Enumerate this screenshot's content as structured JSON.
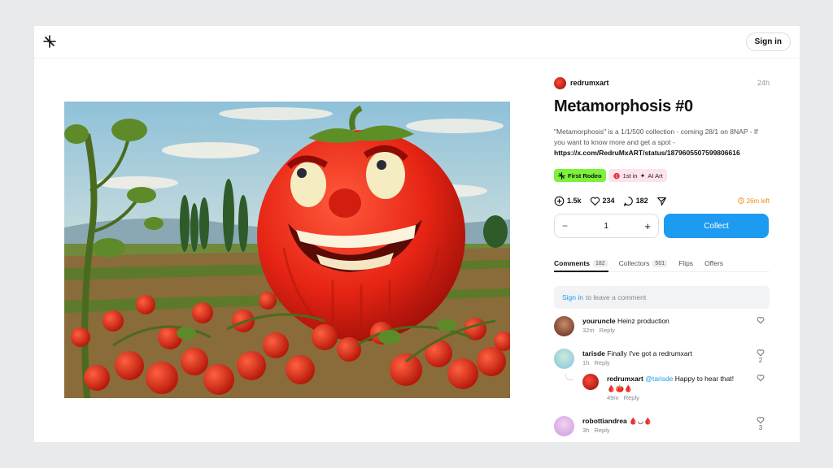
{
  "header": {
    "signin_label": "Sign in"
  },
  "post": {
    "author": "redrumxart",
    "time": "24h",
    "title": "Metamorphosis #0",
    "description": "\"Metamorphosis\" is a 1/1/500 collection - coming 28/1 on 8NAP - If you want to know more and get a spot -",
    "link": "https://x.com/RedruMxART/status/1879605507599806616",
    "tags": {
      "first_rodeo": "First Rodeo",
      "first_in": "1st in",
      "ai_art": "AI Art"
    },
    "stats": {
      "collects": "1.5k",
      "likes": "234",
      "comments": "182"
    },
    "time_left": "26m left",
    "quantity": "1",
    "minus": "−",
    "plus": "+",
    "collect_label": "Collect"
  },
  "tabs": [
    {
      "label": "Comments",
      "count": "182"
    },
    {
      "label": "Collectors",
      "count": "501"
    },
    {
      "label": "Flips"
    },
    {
      "label": "Offers"
    }
  ],
  "comment_box": {
    "signin": "Sign in",
    "placeholder": "to leave a comment"
  },
  "comments": [
    {
      "user": "youruncle",
      "text": "Heinz production",
      "time": "32m",
      "reply": "Reply",
      "likes": ""
    },
    {
      "user": "tarisde",
      "text": "Finally I've got a redrumxart",
      "time": "1h",
      "reply": "Reply",
      "likes": "2"
    },
    {
      "user": "redrumxart",
      "mention": "@tarisde",
      "text": "Happy to hear that!",
      "extra": "🩸🍅🩸",
      "time": "49m",
      "reply": "Reply",
      "likes": ""
    },
    {
      "user": "robottiandrea",
      "text": "🩸◡🩸",
      "time": "3h",
      "reply": "Reply",
      "likes": "3"
    }
  ],
  "colors": {
    "accent": "#1d9bf0",
    "green_tag": "#7cf23a",
    "orange": "#f08a18"
  }
}
